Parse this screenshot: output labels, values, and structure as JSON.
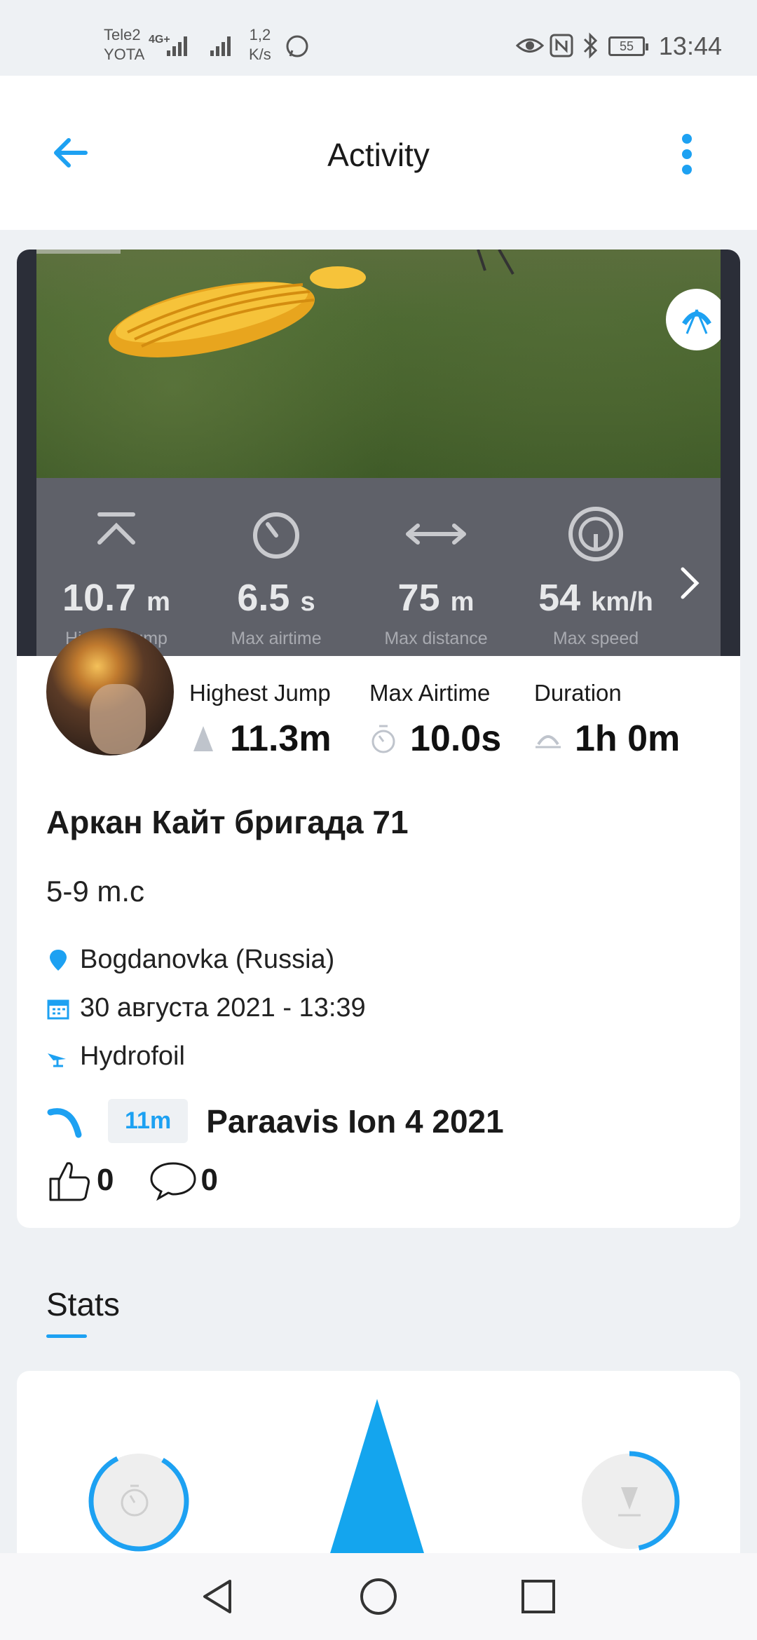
{
  "status_bar": {
    "carrier_1": "Tele2",
    "carrier_2": "YOTA",
    "network": "4G+",
    "speed_value": "1,2",
    "speed_unit": "K/s",
    "battery": "55",
    "time": "13:44"
  },
  "app_bar": {
    "title": "Activity"
  },
  "overlay_stats": [
    {
      "value": "10.7",
      "unit": "m",
      "label": "Highest jump",
      "icon": "jump-icon"
    },
    {
      "value": "6.5",
      "unit": "s",
      "label": "Max airtime",
      "icon": "timer-icon"
    },
    {
      "value": "75",
      "unit": "m",
      "label": "Max distance",
      "icon": "distance-icon"
    },
    {
      "value": "54",
      "unit": "km/h",
      "label": "Max speed",
      "icon": "speedometer-icon"
    }
  ],
  "summary": [
    {
      "label": "Highest Jump",
      "value": "11.3m",
      "icon": "jump-icon"
    },
    {
      "label": "Max Airtime",
      "value": "10.0s",
      "icon": "stopwatch-icon"
    },
    {
      "label": "Duration",
      "value": "1h 0m",
      "icon": "duration-icon"
    }
  ],
  "session": {
    "name": "Аркан Кайт бригада 71",
    "description": "5-9 m.c",
    "location": "Bogdanovka (Russia)",
    "datetime": "30 августа 2021 - 13:39",
    "discipline": "Hydrofoil",
    "gear_size": "11m",
    "gear_name": "Paraavis Ion 4 2021",
    "likes": "0",
    "comments": "0"
  },
  "stats_section": {
    "title": "Stats"
  },
  "colors": {
    "accent": "#1da1f2",
    "overlay": "#5f6169"
  }
}
